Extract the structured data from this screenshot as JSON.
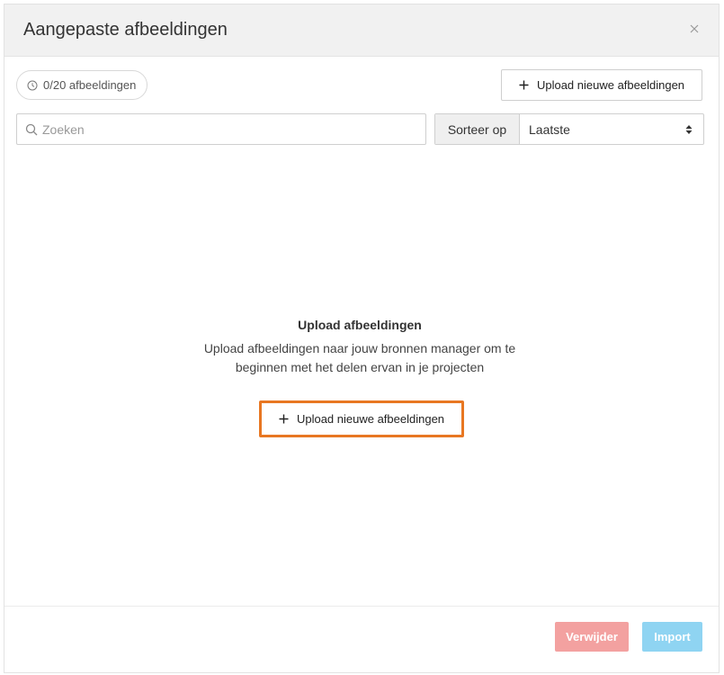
{
  "modal": {
    "title": "Aangepaste afbeeldingen",
    "close_icon": "close-icon"
  },
  "toolbar": {
    "count_label": "0/20 afbeeldingen",
    "count_icon": "clock-icon",
    "upload_label": "Upload nieuwe afbeeldingen",
    "upload_icon": "plus-icon"
  },
  "search": {
    "placeholder": "Zoeken",
    "value": "",
    "icon": "search-icon"
  },
  "sort": {
    "label": "Sorteer op",
    "selected": "Laatste",
    "icon": "sort-arrows-icon"
  },
  "empty_state": {
    "title": "Upload afbeeldingen",
    "text": "Upload afbeeldingen naar jouw bronnen manager om te beginnen met het delen ervan in je projecten",
    "button_label": "Upload nieuwe afbeeldingen",
    "highlight_color": "#e87722"
  },
  "footer": {
    "delete_label": "Verwijder",
    "delete_color": "#f3a1a0",
    "import_label": "Import",
    "import_color": "#8fd4f2"
  }
}
